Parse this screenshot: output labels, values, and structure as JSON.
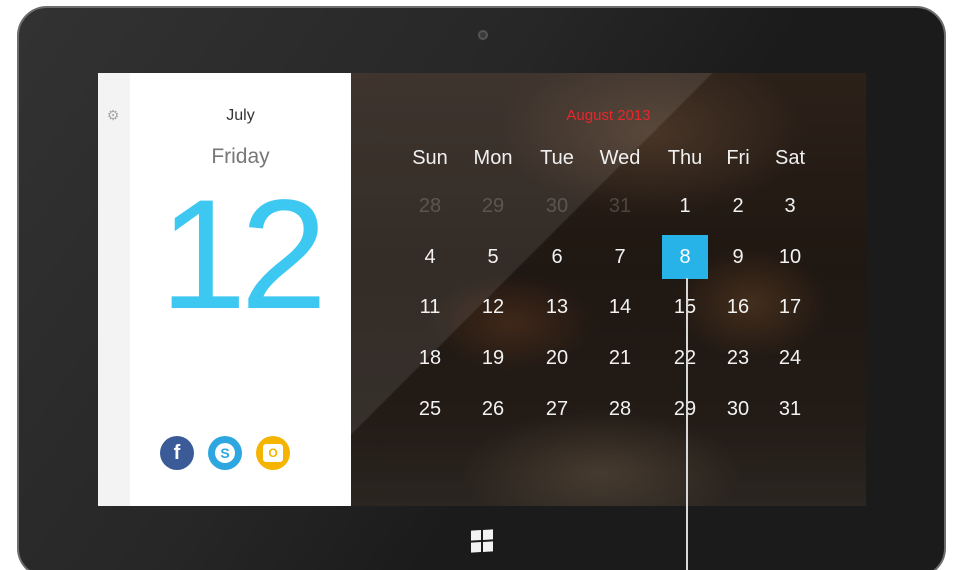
{
  "sidebar": {
    "settings_icon": "gear-icon"
  },
  "date_panel": {
    "month": "July",
    "weekday": "Friday",
    "day": "12",
    "accent_color": "#3dc8f2",
    "social": [
      {
        "name": "facebook",
        "icon": "facebook-icon",
        "glyph": "f",
        "color": "#3a5a98"
      },
      {
        "name": "skype",
        "icon": "skype-icon",
        "glyph": "S",
        "color": "#2ea6e0"
      },
      {
        "name": "outlook",
        "icon": "outlook-icon",
        "glyph": "O",
        "color": "#f5b400"
      }
    ]
  },
  "calendar": {
    "title": "August 2013",
    "title_color": "#e8262c",
    "weekdays": [
      "Sun",
      "Mon",
      "Tue",
      "Wed",
      "Thu",
      "Fri",
      "Sat"
    ],
    "weeks": [
      [
        {
          "d": "28",
          "muted": true
        },
        {
          "d": "29",
          "muted": true
        },
        {
          "d": "30",
          "muted": true
        },
        {
          "d": "31",
          "muted": true
        },
        {
          "d": "1"
        },
        {
          "d": "2"
        },
        {
          "d": "3"
        }
      ],
      [
        {
          "d": "4"
        },
        {
          "d": "5"
        },
        {
          "d": "6"
        },
        {
          "d": "7"
        },
        {
          "d": "8",
          "selected": true
        },
        {
          "d": "9"
        },
        {
          "d": "10"
        }
      ],
      [
        {
          "d": "11"
        },
        {
          "d": "12"
        },
        {
          "d": "13"
        },
        {
          "d": "14"
        },
        {
          "d": "15"
        },
        {
          "d": "16"
        },
        {
          "d": "17"
        }
      ],
      [
        {
          "d": "18"
        },
        {
          "d": "19"
        },
        {
          "d": "20"
        },
        {
          "d": "21"
        },
        {
          "d": "22"
        },
        {
          "d": "23"
        },
        {
          "d": "24"
        }
      ],
      [
        {
          "d": "25"
        },
        {
          "d": "26"
        },
        {
          "d": "27"
        },
        {
          "d": "28"
        },
        {
          "d": "29"
        },
        {
          "d": "30"
        },
        {
          "d": "31"
        }
      ]
    ],
    "selected_color": "#27b2e8"
  },
  "device": {
    "windows_button_icon": "windows-logo-icon"
  }
}
